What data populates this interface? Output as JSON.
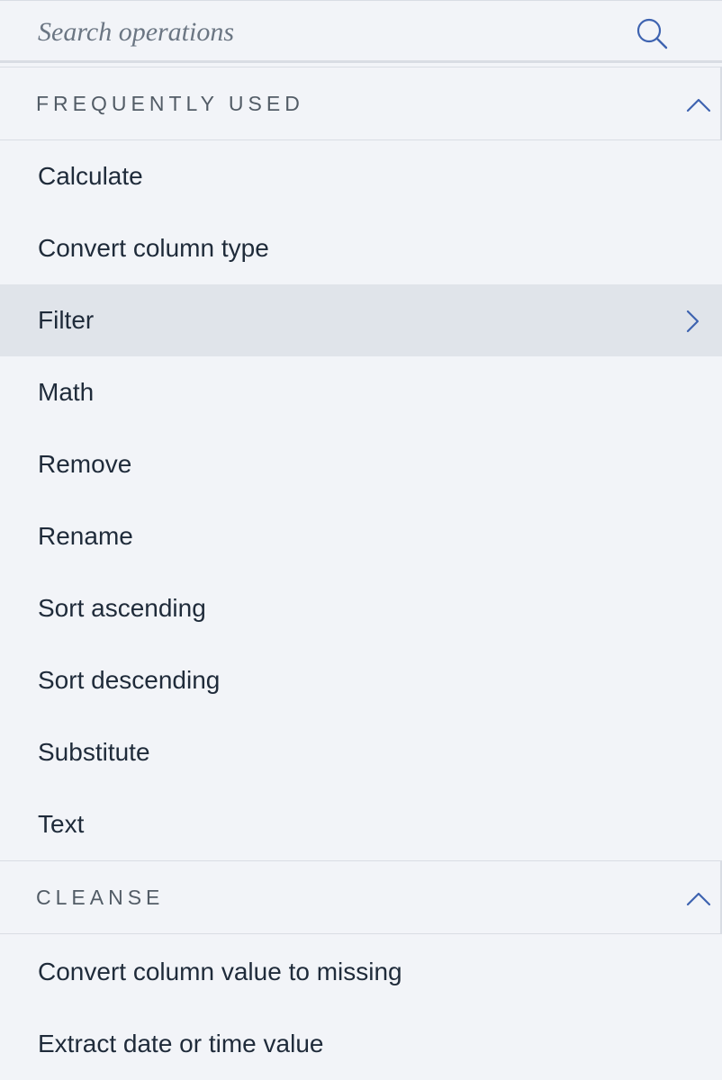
{
  "search": {
    "placeholder": "Search operations",
    "icon": "search-icon"
  },
  "sections": {
    "frequently_used": {
      "title": "FREQUENTLY USED",
      "expanded": true,
      "items": [
        {
          "label": "Calculate"
        },
        {
          "label": "Convert column type"
        },
        {
          "label": "Filter",
          "active": true
        },
        {
          "label": "Math"
        },
        {
          "label": "Remove"
        },
        {
          "label": "Rename"
        },
        {
          "label": "Sort ascending"
        },
        {
          "label": "Sort descending"
        },
        {
          "label": "Substitute"
        },
        {
          "label": "Text"
        }
      ]
    },
    "cleanse": {
      "title": "CLEANSE",
      "expanded": true,
      "items": [
        {
          "label": "Convert column value to missing"
        },
        {
          "label": "Extract date or time value"
        }
      ]
    }
  },
  "colors": {
    "background": "#f2f4f8",
    "active_row": "#e0e4ea",
    "accent": "#3e63b0",
    "text": "#1f2b3a",
    "section_text": "#525c66"
  }
}
